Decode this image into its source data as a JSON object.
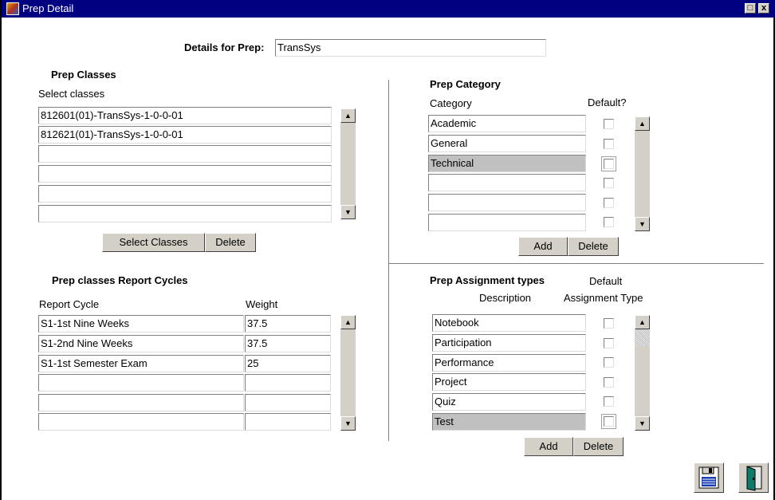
{
  "window": {
    "title": "Prep Detail",
    "restore_label": "□",
    "close_label": "x"
  },
  "prep": {
    "label": "Details for Prep:",
    "value": "TransSys"
  },
  "classes": {
    "heading": "Prep Classes",
    "sub": "Select classes",
    "rows": [
      "812601(01)-TransSys-1-0-0-01",
      "812621(01)-TransSys-1-0-0-01",
      "",
      "",
      "",
      ""
    ],
    "select_btn": "Select Classes",
    "delete_btn": "Delete"
  },
  "category": {
    "heading": "Prep Category",
    "col_category": "Category",
    "col_default": "Default?",
    "rows": [
      "Academic",
      "General",
      "Technical",
      "",
      "",
      ""
    ],
    "selected_index": 2,
    "add_btn": "Add",
    "delete_btn": "Delete"
  },
  "cycles": {
    "heading": "Prep classes Report Cycles",
    "col_cycle": "Report Cycle",
    "col_weight": "Weight",
    "rows": [
      {
        "cycle": "S1-1st Nine Weeks",
        "weight": "37.5"
      },
      {
        "cycle": "S1-2nd Nine Weeks",
        "weight": "37.5"
      },
      {
        "cycle": "S1-1st Semester Exam",
        "weight": "25"
      },
      {
        "cycle": "",
        "weight": ""
      },
      {
        "cycle": "",
        "weight": ""
      },
      {
        "cycle": "",
        "weight": ""
      }
    ]
  },
  "assign": {
    "heading": "Prep Assignment types",
    "col_default_1": "Default",
    "col_desc": "Description",
    "col_default_2": "Assignment Type",
    "rows": [
      "Notebook",
      "Participation",
      "Performance",
      "Project",
      "Quiz",
      "Test"
    ],
    "selected_index": 5,
    "add_btn": "Add",
    "delete_btn": "Delete"
  },
  "toolbar": {
    "save_icon": "save-icon",
    "exit_icon": "exit-door-icon"
  },
  "colors": {
    "titlebar": "#000080",
    "button_face": "#d4d0c8",
    "selected_row": "#c0c0c0"
  }
}
